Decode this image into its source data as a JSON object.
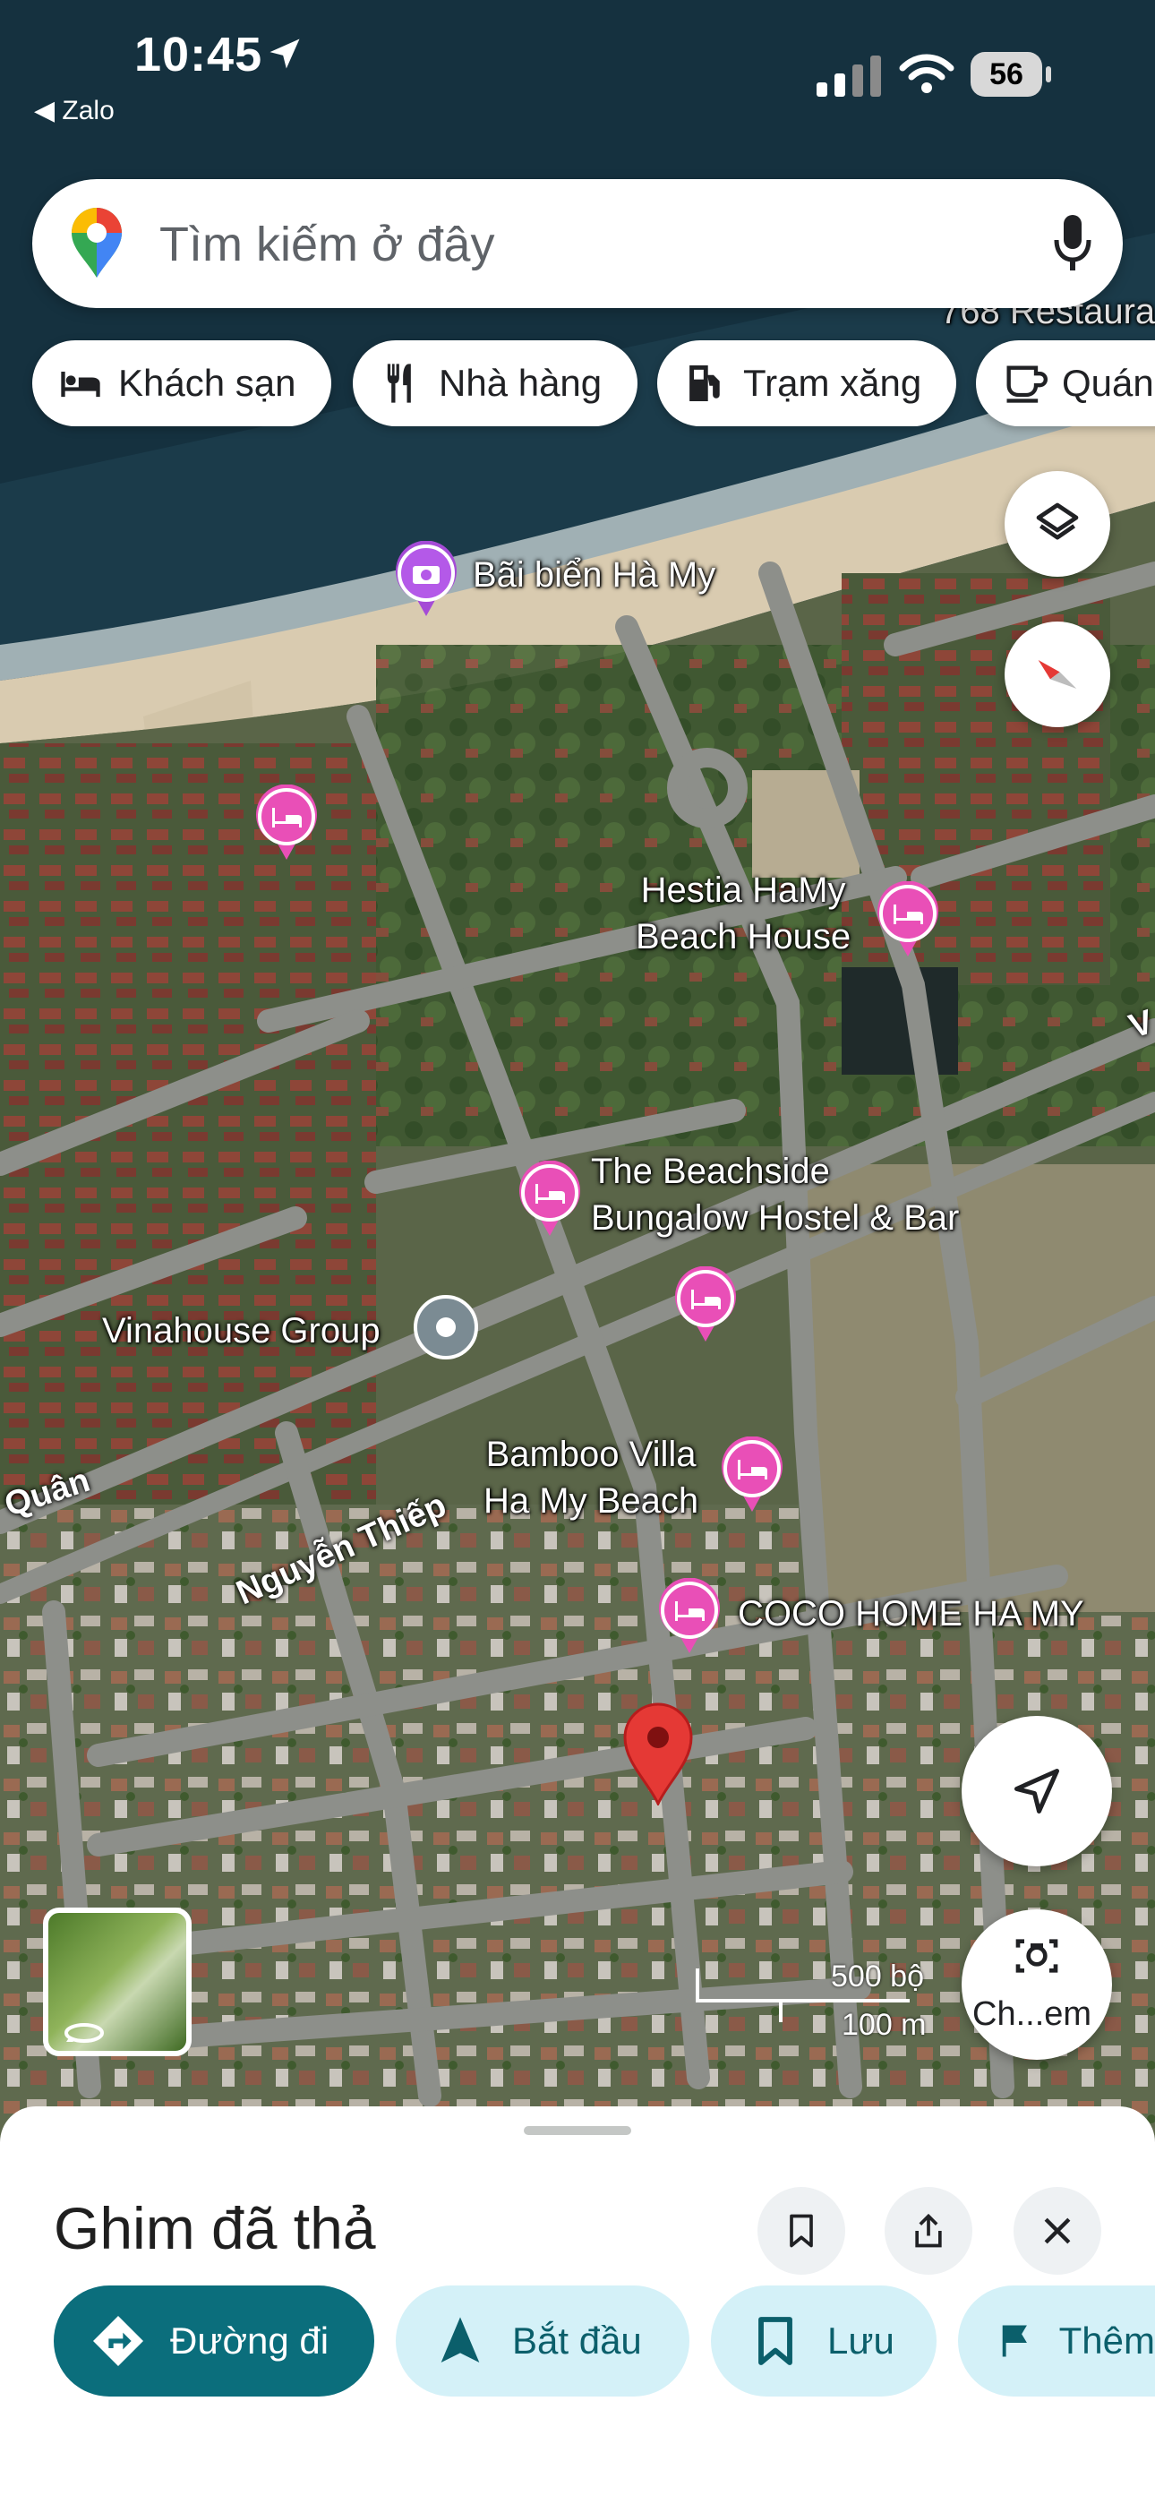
{
  "status_bar": {
    "time": "10:45",
    "back_app": "◀ Zalo",
    "battery": "56"
  },
  "search": {
    "placeholder": "Tìm kiếm ở đây"
  },
  "chips": [
    {
      "label": "Khách sạn",
      "icon": "bed-icon"
    },
    {
      "label": "Nhà hàng",
      "icon": "restaurant-icon"
    },
    {
      "label": "Trạm xăng",
      "icon": "gas-station-icon"
    },
    {
      "label": "Quán",
      "icon": "cafe-icon"
    }
  ],
  "map": {
    "labels": {
      "restaurant_partial": "768 Restaura",
      "beach": "Bãi biển Hà My",
      "hestia": "Hestia HaMy\nBeach House",
      "beachside": "The Beachside\nBungalow Hostel & Bar",
      "vinahouse": "Vinahouse Group",
      "bamboo": "Bamboo Villa\nHa My Beach",
      "coco": "COCO HOME HA MY",
      "road_quan": "Quân",
      "road_nguyen_thiep": "Nguyễn Thiếp",
      "road_v": "V"
    },
    "scale": {
      "imperial": "500 bộ",
      "metric": "100 m"
    },
    "screenshot_button_label": "Ch...em"
  },
  "sheet": {
    "title": "Ghim đã thả",
    "actions": [
      {
        "label": "Đường đi",
        "icon": "directions-icon"
      },
      {
        "label": "Bắt đầu",
        "icon": "navigation-arrow-icon"
      },
      {
        "label": "Lưu",
        "icon": "bookmark-icon"
      },
      {
        "label": "Thêm",
        "icon": "flag-icon"
      }
    ]
  },
  "colors": {
    "accent": "#0b6e7c",
    "secondary_chip": "#d4f1f8",
    "poi_pink": "#e94fb7",
    "drop_pin": "#e53935"
  }
}
